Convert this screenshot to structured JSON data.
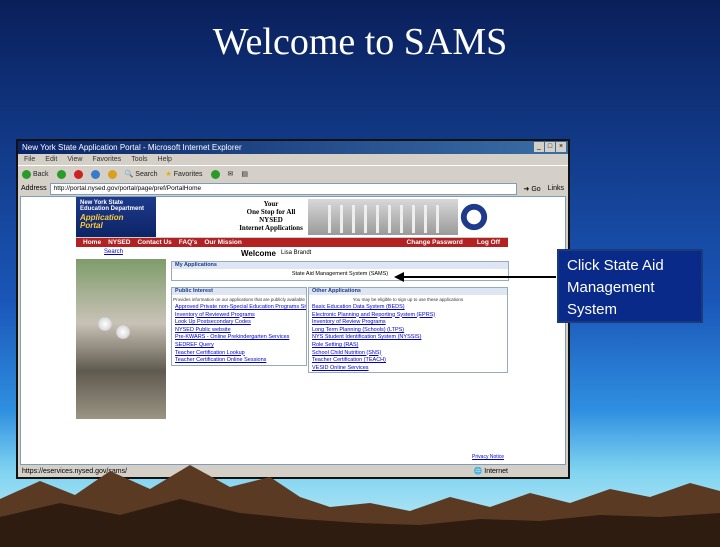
{
  "slide": {
    "title": "Welcome to SAMS",
    "callout": "Click State Aid Management System"
  },
  "browser": {
    "title": "New York State Application Portal - Microsoft Internet Explorer",
    "menu": [
      "File",
      "Edit",
      "View",
      "Favorites",
      "Tools",
      "Help"
    ],
    "toolbar": {
      "back": "Back",
      "search": "Search",
      "favorites": "Favorites"
    },
    "address_label": "Address",
    "address": "http://portal.nysed.gov/portal/page/pref/PortalHome",
    "go": "Go",
    "links": "Links",
    "status_left": "https://eservices.nysed.gov/sams/",
    "status_right": "Internet"
  },
  "portal": {
    "dept": "New York State Education Department",
    "logo": "Application Portal",
    "tagline": [
      "Your",
      "One Stop for All",
      "NYSED",
      "Internet Applications"
    ],
    "nav_left": [
      "Home",
      "NYSED",
      "Contact Us",
      "FAQ's",
      "Our Mission"
    ],
    "nav_right": [
      "Change Password",
      "Log Off"
    ],
    "search_link": "Search",
    "welcome": "Welcome",
    "user_name": "Lisa Brandt",
    "my_apps_title": "My Applications",
    "my_apps_item": "State Aid Management System (SAMS)",
    "public_interest": {
      "title": "Public Interest",
      "note": "Provides information on our applications that are publicly available",
      "links": [
        "Approved Private non-Special Education Programs Site Search",
        "Inventory of Reviewed Programs",
        "Look Up Postsecondary Codes",
        "NYSED Public website",
        "Pre-KWARS - Online Prekindergarten Services",
        "SEDREF Query",
        "Teacher Certification Lookup",
        "Teacher Certification Online Sessions"
      ]
    },
    "other_apps": {
      "title": "Other Applications",
      "note": "You may be eligible to sign up to use these applications",
      "links": [
        "Basic Education Data System (BEDS)",
        "Electronic Planning and Reporting System (EPRS)",
        "Inventory of Review Programs",
        "Long Term Planning (Schools) (LTPS)",
        "NYS Student Identification System (NYSSIS)",
        "Role Setting (RAS)",
        "School Child Nutrition (SNS)",
        "Teacher Certification (TEACH)",
        "VESID Online Services"
      ]
    },
    "privacy": "Privacy Notice"
  }
}
